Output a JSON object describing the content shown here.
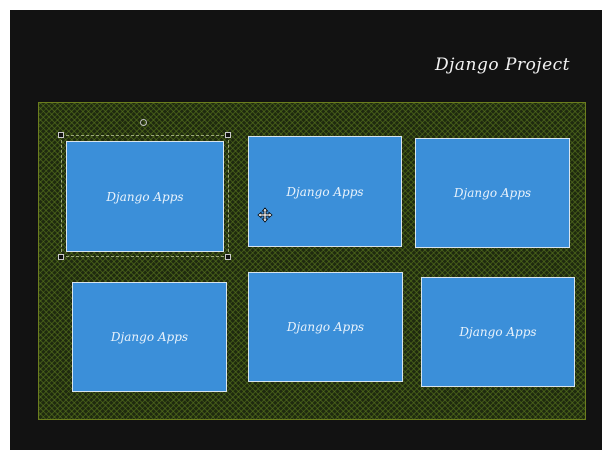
{
  "canvas": {
    "title": "Django Project",
    "background": "#121212",
    "frame_color": "#1f2a0f",
    "box_color": "#3b8fd9"
  },
  "apps": [
    {
      "label": "Django Apps"
    },
    {
      "label": "Django Apps"
    },
    {
      "label": "Django Apps"
    },
    {
      "label": "Django Apps"
    },
    {
      "label": "Django Apps"
    },
    {
      "label": "Django Apps"
    }
  ],
  "cursor": "move-cursor-icon"
}
